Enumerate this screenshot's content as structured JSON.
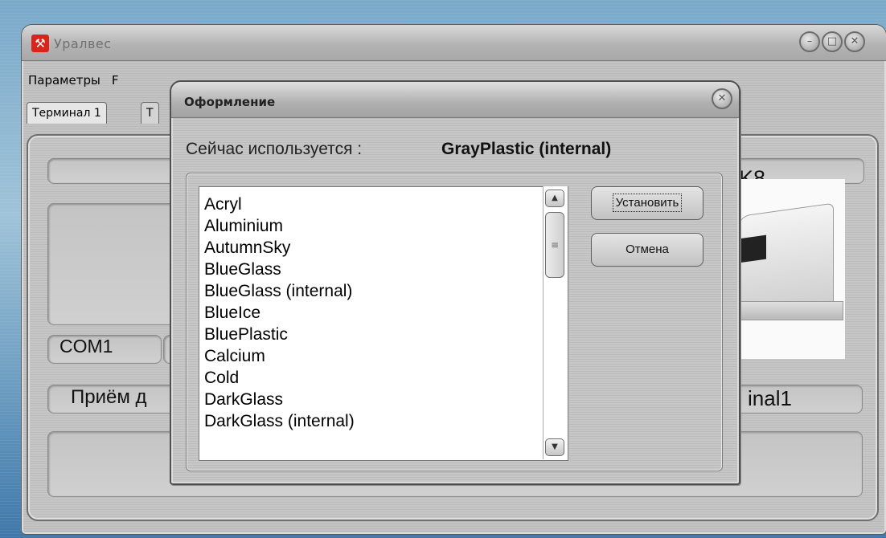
{
  "window": {
    "title": "Уралвес",
    "icon": "tools-icon"
  },
  "menu": {
    "items": [
      "Параметры",
      "F"
    ]
  },
  "tabs": [
    {
      "label": "Терминал 1",
      "active": true
    },
    {
      "label": "Т",
      "active": false
    }
  ],
  "panel": {
    "com_port": "COM1",
    "partial_model_text": "K8",
    "partial_status_left": "Приём д",
    "partial_status_right": "inal1"
  },
  "dialog": {
    "title": "Оформление",
    "current_label": "Сейчас используется :",
    "current_value": "GrayPlastic (internal)",
    "skins": [
      "Acryl",
      "Aluminium",
      "AutumnSky",
      "BlueGlass",
      "BlueGlass (internal)",
      "BlueIce",
      "BluePlastic",
      "Calcium",
      "Cold",
      "DarkGlass",
      "DarkGlass (internal)"
    ],
    "install_button": "Установить",
    "cancel_button": "Отмена"
  }
}
